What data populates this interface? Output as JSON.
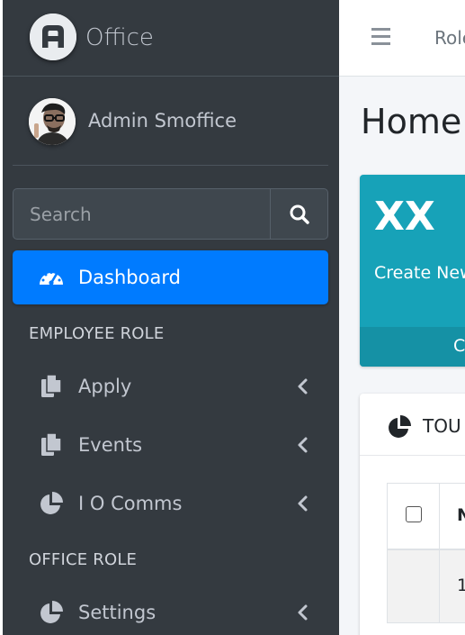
{
  "brand": {
    "name": "Office"
  },
  "user": {
    "name": "Admin Smoffice"
  },
  "search": {
    "placeholder": "Search"
  },
  "nav": {
    "dashboard": "Dashboard",
    "header_employee": "EMPLOYEE ROLE",
    "apply": "Apply",
    "events": "Events",
    "io_comms": "I O Comms",
    "header_office": "OFFICE ROLE",
    "settings": "Settings"
  },
  "topbar": {
    "link": "Role"
  },
  "page": {
    "title": "Home:"
  },
  "info_box": {
    "number": "XX",
    "text": "Create New",
    "footer": "C"
  },
  "card": {
    "title": "TOU",
    "column": "N",
    "row_value": "1"
  },
  "colors": {
    "sidebar": "#343a40",
    "active": "#007bff",
    "info": "#17a2b8"
  }
}
